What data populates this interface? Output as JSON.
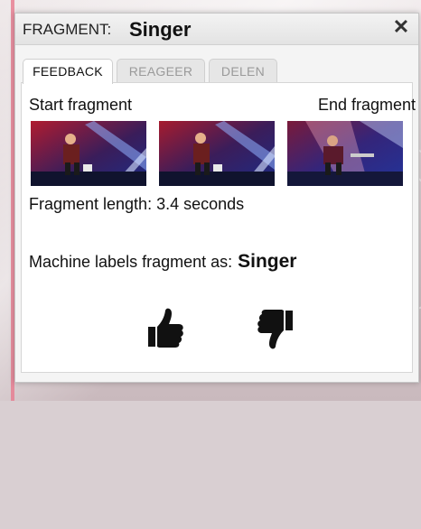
{
  "dialog": {
    "title_prefix": "FRAGMENT:",
    "title_name": "Singer",
    "close_glyph": "✕"
  },
  "tabs": [
    {
      "label": "FEEDBACK",
      "active": true
    },
    {
      "label": "REAGEER",
      "active": false
    },
    {
      "label": "DELEN",
      "active": false
    }
  ],
  "feedback": {
    "start_label": "Start fragment",
    "end_label": "End fragment",
    "length_text": "Fragment length: 3.4 seconds",
    "machine_label_text": "Machine labels fragment as:",
    "machine_label_value": "Singer"
  },
  "icons": {
    "close": "close-icon",
    "like": "thumbs-up-icon",
    "dislike": "thumbs-down-icon"
  },
  "colors": {
    "stage_red": "#c0203a",
    "stage_blue": "#2a3f9c",
    "icon_dark": "#111111"
  }
}
